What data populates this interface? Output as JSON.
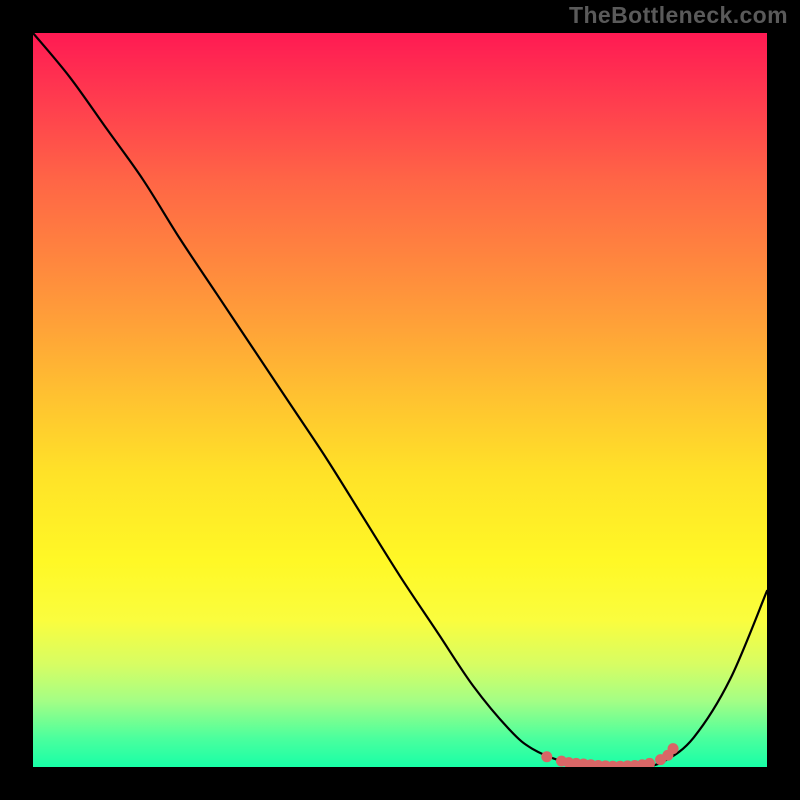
{
  "watermark": "TheBottleneck.com",
  "chart_data": {
    "type": "line",
    "title": "",
    "xlabel": "",
    "ylabel": "",
    "xlim": [
      0,
      100
    ],
    "ylim": [
      0,
      100
    ],
    "grid": false,
    "legend": false,
    "series": [
      {
        "name": "bottleneck-curve",
        "color": "#000000",
        "x": [
          0,
          5,
          10,
          15,
          20,
          25,
          30,
          35,
          40,
          45,
          50,
          55,
          60,
          65,
          68,
          72,
          75,
          78,
          80,
          83,
          86,
          90,
          95,
          100
        ],
        "y": [
          100,
          94,
          87,
          80,
          72,
          64.5,
          57,
          49.5,
          42,
          34,
          26,
          18.5,
          11,
          5,
          2.5,
          0.8,
          0.3,
          0,
          0,
          0,
          0.8,
          4,
          12,
          24
        ]
      }
    ],
    "markers": {
      "name": "optimal-range",
      "color": "#d86666",
      "x": [
        70,
        72,
        73,
        74,
        75,
        76,
        77,
        78,
        79,
        80,
        81,
        82,
        83,
        84,
        85.5,
        86.5,
        87.2
      ],
      "y": [
        1.4,
        0.8,
        0.6,
        0.5,
        0.4,
        0.3,
        0.2,
        0.15,
        0.1,
        0.1,
        0.15,
        0.2,
        0.3,
        0.5,
        1.0,
        1.6,
        2.5
      ]
    },
    "gradient_stops": [
      {
        "pos": 0,
        "color": "#ff1a53"
      },
      {
        "pos": 10,
        "color": "#ff3f4e"
      },
      {
        "pos": 20,
        "color": "#ff6546"
      },
      {
        "pos": 30,
        "color": "#ff833f"
      },
      {
        "pos": 40,
        "color": "#ffa238"
      },
      {
        "pos": 50,
        "color": "#ffc330"
      },
      {
        "pos": 60,
        "color": "#ffe228"
      },
      {
        "pos": 72,
        "color": "#fff826"
      },
      {
        "pos": 80,
        "color": "#fafd3e"
      },
      {
        "pos": 86,
        "color": "#d7fd63"
      },
      {
        "pos": 91,
        "color": "#a4fe85"
      },
      {
        "pos": 96,
        "color": "#4cff9d"
      },
      {
        "pos": 100,
        "color": "#18ffa7"
      }
    ]
  }
}
